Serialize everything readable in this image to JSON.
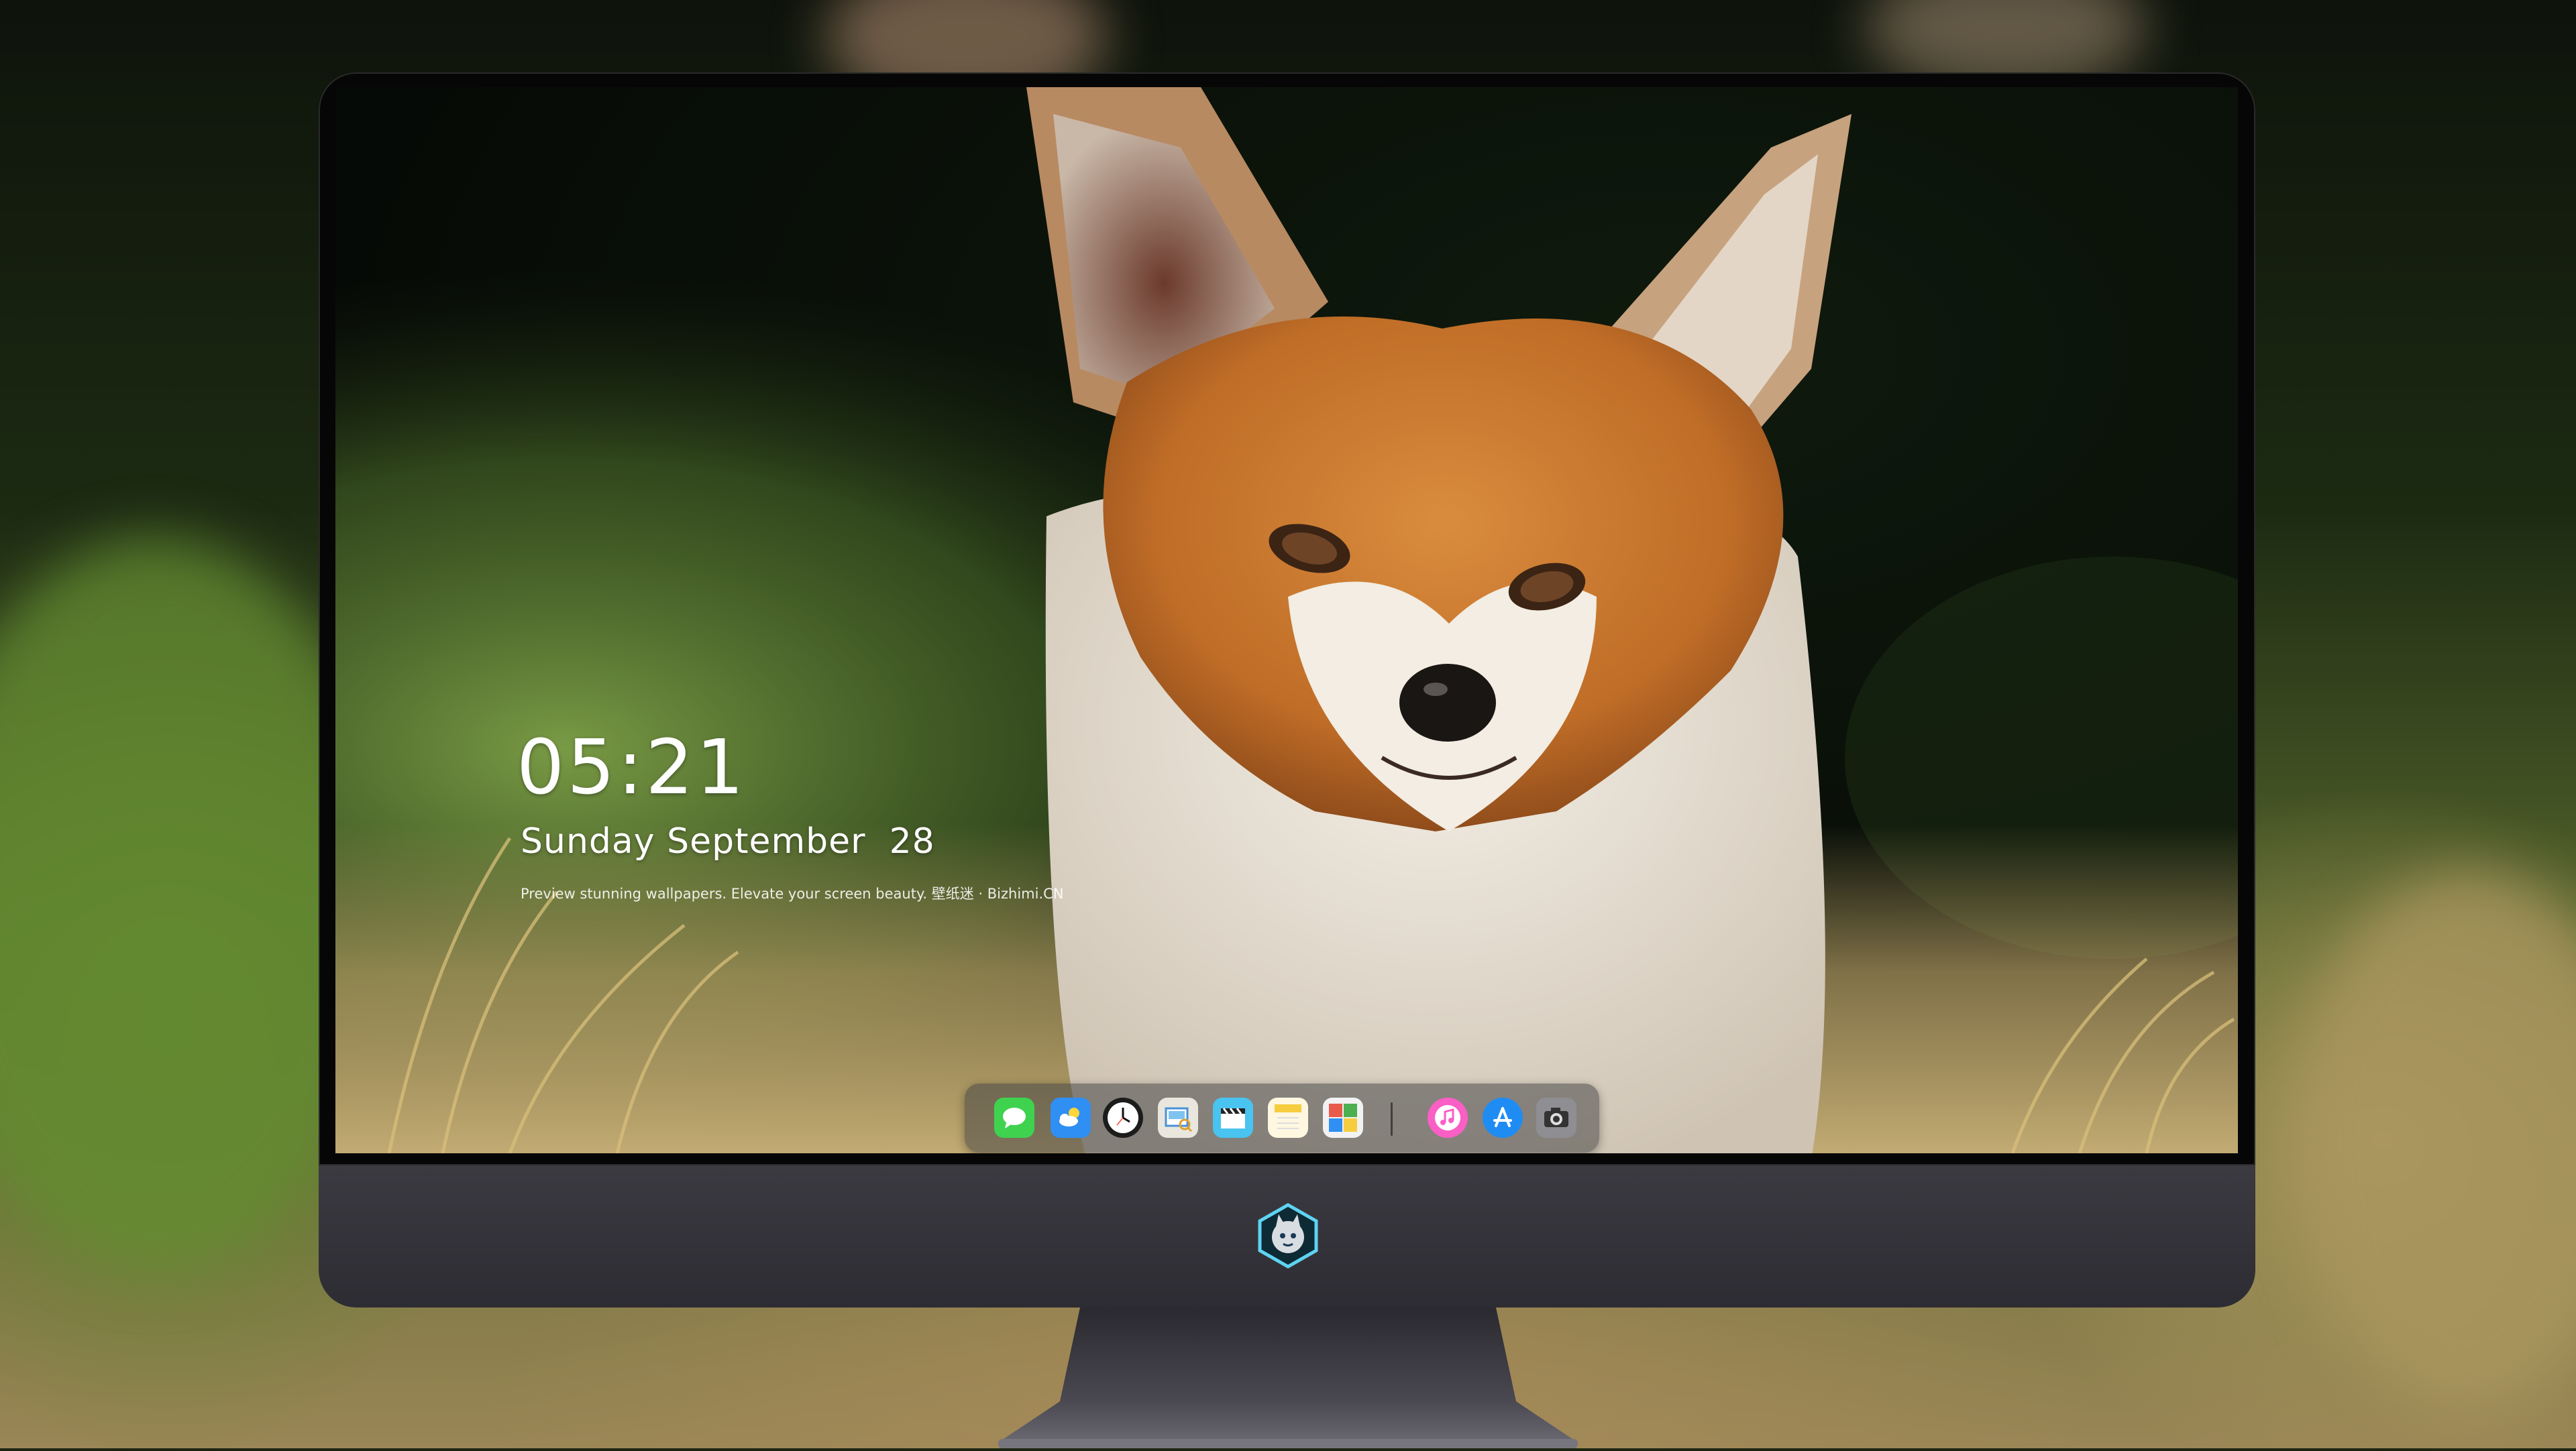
{
  "lock_screen": {
    "time": "05:21",
    "date": "Sunday September  28",
    "caption": "Preview stunning wallpapers. Elevate your screen beauty. 壁纸迷 · Bizhimi.CN"
  },
  "wallpaper": {
    "subject": "red-fox-portrait"
  },
  "dock": {
    "apps": [
      {
        "name": "Messages",
        "icon": "messages-icon",
        "color": "#3fd24f"
      },
      {
        "name": "Weather",
        "icon": "weather-icon",
        "color": "#2f8ff2"
      },
      {
        "name": "Clock",
        "icon": "clock-icon",
        "color": "#f5f5f5"
      },
      {
        "name": "Preview",
        "icon": "preview-icon",
        "color": "#e9e7dd"
      },
      {
        "name": "Clips",
        "icon": "clapperboard-icon",
        "color": "#49c3ef"
      },
      {
        "name": "Notes",
        "icon": "notes-icon",
        "color": "#f6cd3f"
      },
      {
        "name": "Photo Booth",
        "icon": "photo-gallery-icon",
        "color": "#e85b4c"
      },
      {
        "name": "Music",
        "icon": "music-icon",
        "color": "#fa5fc6"
      },
      {
        "name": "App Store",
        "icon": "app-store-icon",
        "color": "#1f8cf4"
      },
      {
        "name": "Camera",
        "icon": "camera-icon",
        "color": "#8e8e93"
      }
    ]
  },
  "chin_logo": {
    "icon": "mascot-logo-icon",
    "color": "#5fd3f2"
  },
  "colors": {
    "bezel": "#060606",
    "chin": "#35333a",
    "stand": "#4a4850"
  }
}
